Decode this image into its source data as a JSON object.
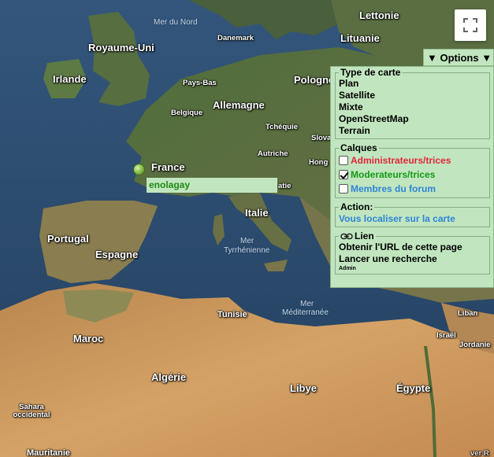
{
  "map": {
    "countries": [
      {
        "name": "Lettonie"
      },
      {
        "name": "Lituanie"
      },
      {
        "name": "Royaume-Uni"
      },
      {
        "name": "Danemark"
      },
      {
        "name": "Irlande"
      },
      {
        "name": "Pays-Bas"
      },
      {
        "name": "Pologne"
      },
      {
        "name": "Allemagne"
      },
      {
        "name": "Belgique"
      },
      {
        "name": "Tchéquie"
      },
      {
        "name": "Slova"
      },
      {
        "name": "Autriche"
      },
      {
        "name": "Hong"
      },
      {
        "name": "France"
      },
      {
        "name": "atie"
      },
      {
        "name": "Italie"
      },
      {
        "name": "Portugal"
      },
      {
        "name": "Espagne"
      },
      {
        "name": "Tunisie"
      },
      {
        "name": "Liban"
      },
      {
        "name": "Israël"
      },
      {
        "name": "Jordanie"
      },
      {
        "name": "Maroc"
      },
      {
        "name": "Algérie"
      },
      {
        "name": "Libye"
      },
      {
        "name": "Égypte"
      },
      {
        "name": "Sahara occidental"
      },
      {
        "name": "Mauritanie"
      },
      {
        "name": "ver R"
      }
    ],
    "seas": {
      "north": "Mer du Nord",
      "tyrrhenian_1": "Mer",
      "tyrrhenian_2": "Tyrrhénienne",
      "med_1": "Mer",
      "med_2": "Méditerranée"
    }
  },
  "marker": {
    "label": "enolagay",
    "icon": "green-sphere-marker",
    "label_color": "#1f8a14"
  },
  "fullscreen": {
    "icon": "fullscreen-icon"
  },
  "options": {
    "toggle_label": "▼ Options ▼",
    "map_type": {
      "legend": "Type de carte",
      "items": [
        "Plan",
        "Satellite",
        "Mixte",
        "OpenStreetMap",
        "Terrain"
      ]
    },
    "layers": {
      "legend": "Calques",
      "items": [
        {
          "label": "Administrateurs/trices",
          "checked": false,
          "color": "#e2253a"
        },
        {
          "label": "Moderateurs/trices",
          "checked": true,
          "color": "#139a14"
        },
        {
          "label": "Membres du forum",
          "checked": false,
          "color": "#2f84d8"
        }
      ]
    },
    "action": {
      "legend": "Action:",
      "locate_label": "Vous localiser sur la carte"
    },
    "link": {
      "legend": "Lien",
      "icon": "link-icon",
      "items": [
        "Obtenir l'URL de cette page",
        "Lancer une recherche"
      ],
      "admin": "Admin"
    }
  },
  "colors": {
    "panel_bg": "#c1e6bf",
    "sea": "#2c4a6e",
    "land_green": "#4d6b3a",
    "desert": "#c99457"
  }
}
